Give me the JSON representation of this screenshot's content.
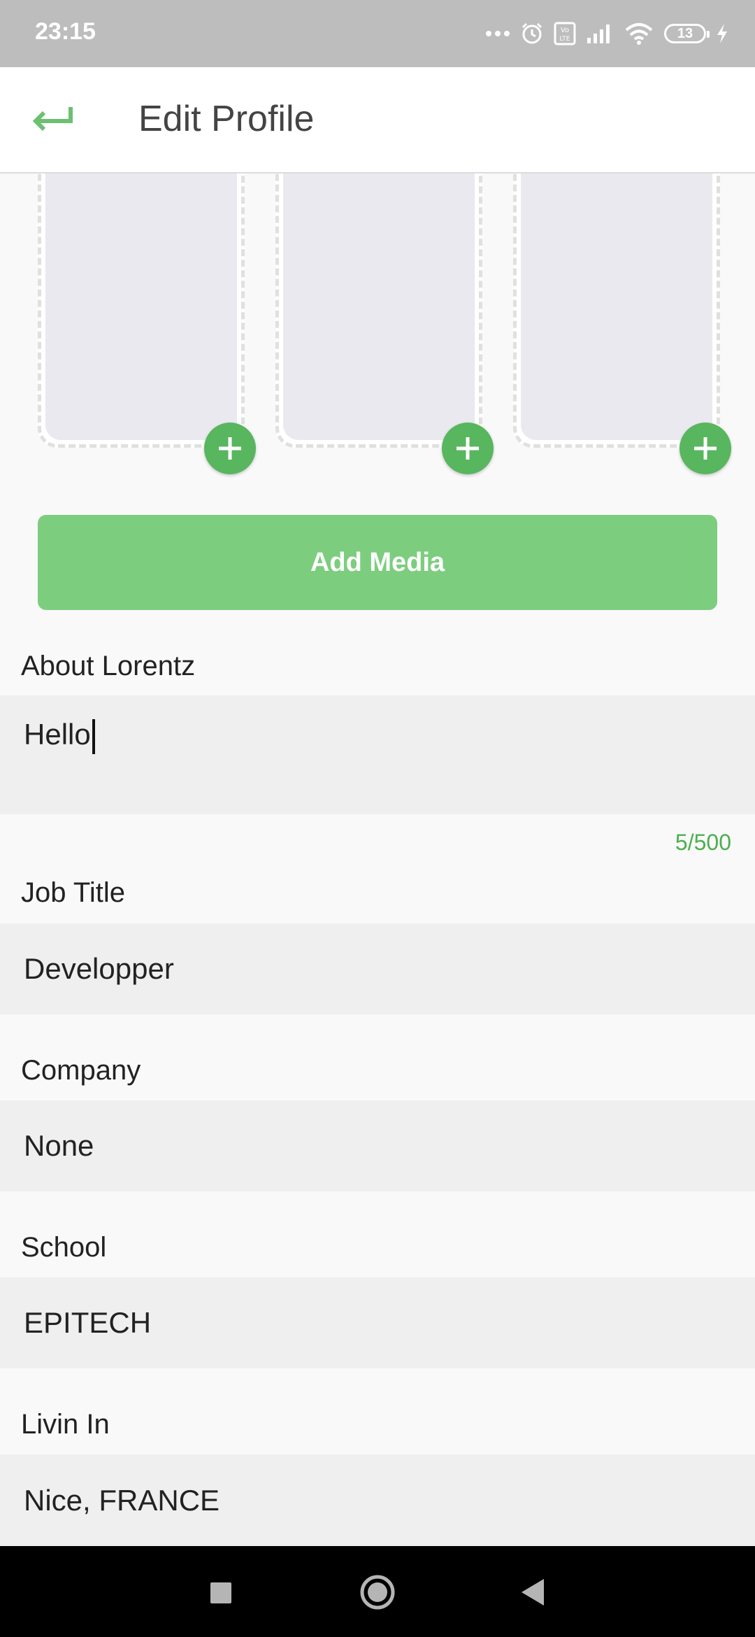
{
  "status_bar": {
    "time": "23:15",
    "battery_level": "13",
    "icons": [
      "more-dots-icon",
      "alarm-icon",
      "volte-icon",
      "signal-icon",
      "wifi-icon",
      "battery-icon",
      "charging-icon"
    ]
  },
  "app_bar": {
    "title": "Edit Profile",
    "back_icon": "back-arrow-icon"
  },
  "media": {
    "tiles": [
      {
        "add_icon": "plus-icon"
      },
      {
        "add_icon": "plus-icon"
      },
      {
        "add_icon": "plus-icon"
      }
    ],
    "add_button_label": "Add Media"
  },
  "about": {
    "label": "About Lorentz",
    "value": "Hello",
    "counter": "5/500"
  },
  "job_title": {
    "label": "Job Title",
    "value": "Developper"
  },
  "company": {
    "label": "Company",
    "value": "None"
  },
  "school": {
    "label": "School",
    "value": "EPITECH"
  },
  "living_in": {
    "label": "Livin In",
    "value": "Nice, FRANCE"
  },
  "colors": {
    "accent": "#58b65e",
    "button": "#7dcd7f",
    "counter": "#4caf50",
    "status_bar": "#bdbdbd",
    "field_bg": "#efefef"
  },
  "nav_bar": {
    "icons": [
      "recents-square-icon",
      "home-circle-icon",
      "back-triangle-icon"
    ]
  }
}
